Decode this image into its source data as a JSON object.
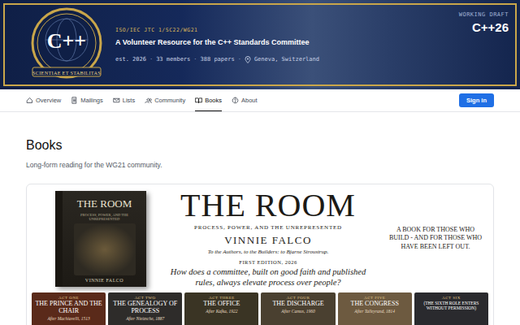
{
  "header": {
    "logo": {
      "text": "C++",
      "motto": "SCIENTIAE ET STABILITAS"
    },
    "org": "ISO/IEC JTC 1/SC22/WG21",
    "tagline": "A Volunteer Resource for the C++ Standards Committee",
    "meta": [
      "est. 2026",
      "33 members",
      "388 papers"
    ],
    "separator": "·",
    "location": "Geneva, Switzerland",
    "draft_label": "WORKING DRAFT",
    "draft_version": "C++26"
  },
  "nav": {
    "items": [
      {
        "label": "Overview",
        "selected": false
      },
      {
        "label": "Mailings",
        "selected": false
      },
      {
        "label": "Lists",
        "selected": false
      },
      {
        "label": "Community",
        "selected": false
      },
      {
        "label": "Books",
        "selected": true
      },
      {
        "label": "About",
        "selected": false
      }
    ],
    "sign_in": "Sign in"
  },
  "page": {
    "title": "Books",
    "subtitle": "Long-form reading for the WG21 community."
  },
  "book": {
    "cover": {
      "title": "THE ROOM",
      "subtitle": "PROCESS, POWER, AND THE UNREPRESENTED",
      "author": "VINNIE FALCO"
    },
    "title": "THE ROOM",
    "subtitle": "PROCESS, POWER, AND THE UNREPRESENTED",
    "author": "VINNIE FALCO",
    "dedication": "To the Authors, to the Builders: to Bjarne Stroustrup.",
    "edition": "FIRST EDITION, 2026",
    "question": "How does a committee, built on good faith and published rules, always elevate process over people?",
    "pitch": "A BOOK FOR THOSE WHO BUILD - AND FOR THOSE WHO HAVE BEEN LEFT OUT.",
    "acts": [
      {
        "act": "ACT ONE",
        "title": "THE PRINCE AND THE CHAIR",
        "after": "After Machiavelli, 1513"
      },
      {
        "act": "ACT TWO",
        "title": "THE GENEALOGY OF PROCESS",
        "after": "After Nietzsche, 1887"
      },
      {
        "act": "ACT THREE",
        "title": "THE OFFICE",
        "after": "After Kafka, 1922"
      },
      {
        "act": "ACT FOUR",
        "title": "THE DISCHARGE",
        "after": "After Camus, 1960"
      },
      {
        "act": "ACT FIVE",
        "title": "THE CONGRESS",
        "after": "After Talleyrand, 1814"
      },
      {
        "act": "ACT SIX",
        "title": "(THE SIXTH ROLE ENTERS WITHOUT PERMISSION)"
      }
    ]
  }
}
